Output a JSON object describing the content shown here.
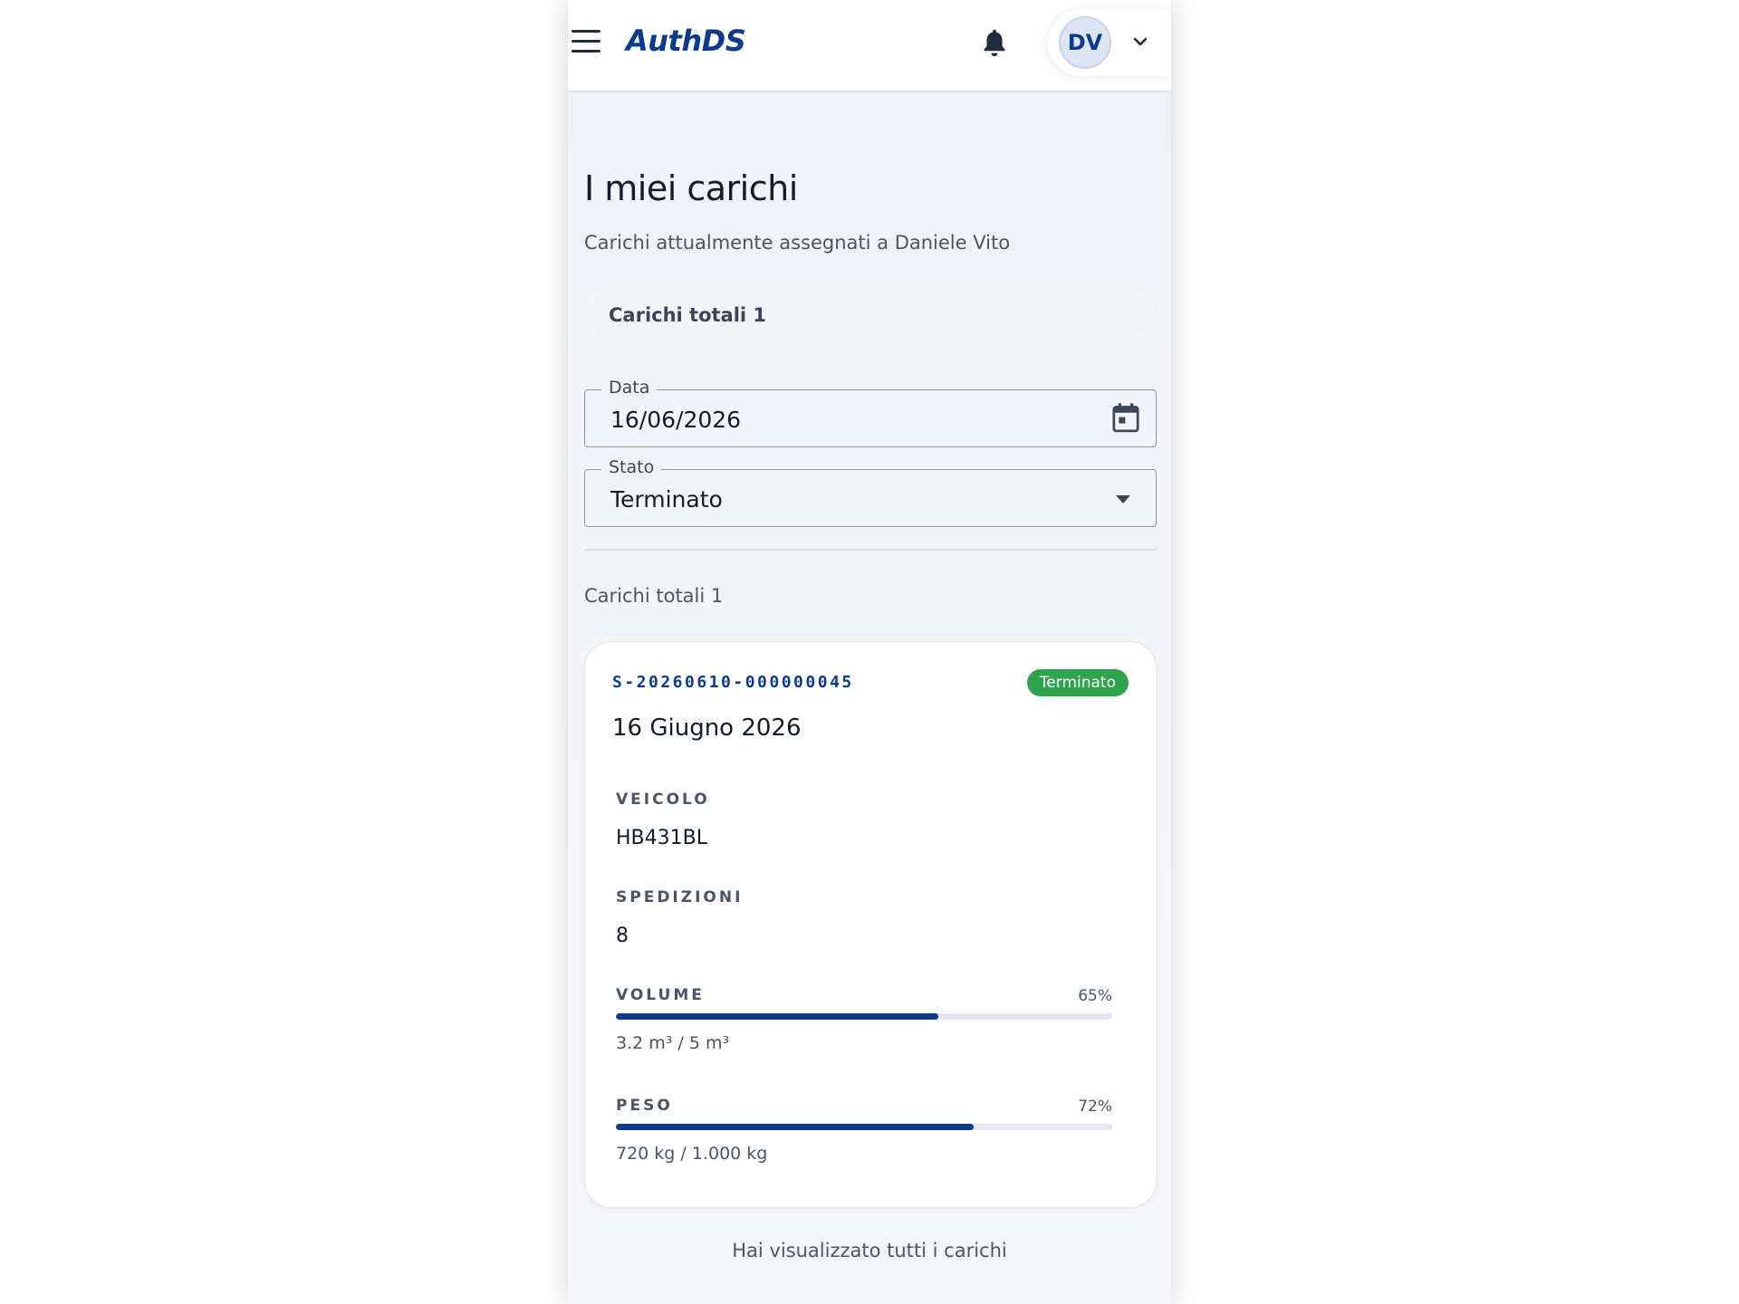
{
  "header": {
    "brand": "AuthDS",
    "avatar_initials": "DV",
    "icons": {
      "menu": "menu-icon",
      "notifications": "bell-icon",
      "user_menu": "chevron-down-icon"
    }
  },
  "page": {
    "title": "I miei carichi",
    "subtitle": "Carichi attualmente assegnati a Daniele Vito",
    "totals_summary": "Carichi totali 1"
  },
  "filters": {
    "date": {
      "label": "Data",
      "value": "16/06/2026",
      "icon": "calendar-icon"
    },
    "status": {
      "label": "Stato",
      "value": "Terminato",
      "icon": "dropdown-arrow-icon"
    }
  },
  "results": {
    "count_label": "Carichi totali 1",
    "loads": [
      {
        "code": "S-20260610-000000045",
        "status": "Terminato",
        "date": "16 Giugno 2026",
        "vehicle_label": "VEICOLO",
        "vehicle": "HB431BL",
        "shipments_label": "SPEDIZIONI",
        "shipments": "8",
        "volume": {
          "label": "VOLUME",
          "percent_label": "65%",
          "fraction": 0.65,
          "detail": "3.2 m³ / 5 m³"
        },
        "weight": {
          "label": "PESO",
          "percent_label": "72%",
          "fraction": 0.72,
          "detail": "720 kg / 1.000 kg"
        }
      }
    ],
    "end_note": "Hai visualizzato tutti i carichi"
  },
  "colors": {
    "brand": "#0d3b8a",
    "status_terminated": "#2ea44f",
    "bar_track": "#e4e7ed"
  }
}
